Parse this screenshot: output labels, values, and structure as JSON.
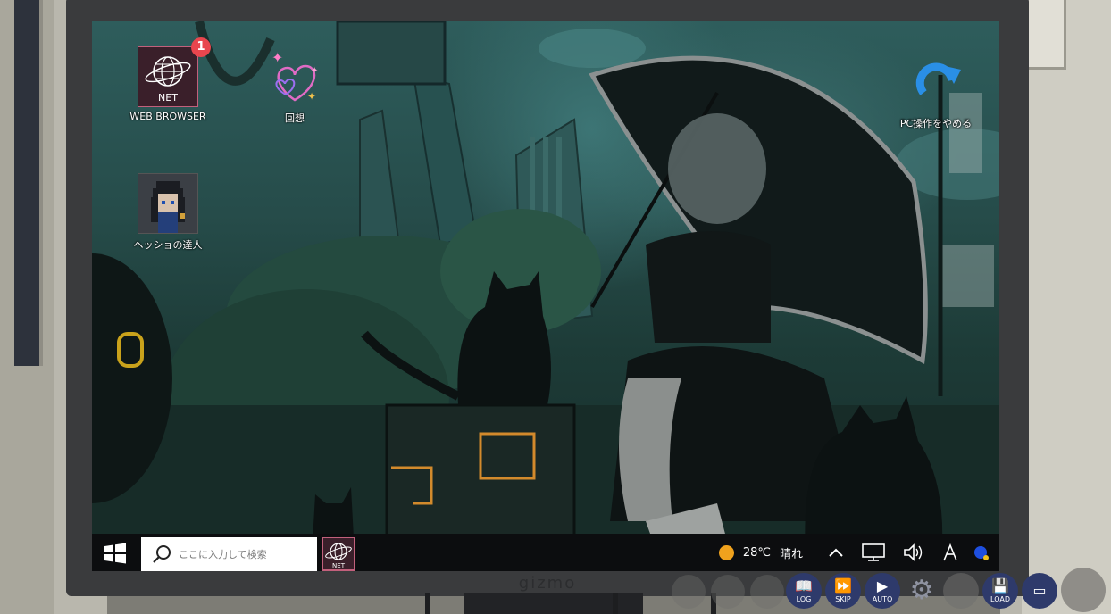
{
  "desktop": {
    "icons": {
      "browser": {
        "tile_text": "NET",
        "label": "WEB BROWSER",
        "badge": "1"
      },
      "memories": {
        "label": "回想"
      },
      "game": {
        "label": "ヘッショの達人"
      },
      "quit": {
        "label": "PC操作をやめる"
      }
    }
  },
  "taskbar": {
    "search_placeholder": "ここに入力して検索",
    "app_tile_text": "NET",
    "weather": {
      "temp": "28℃",
      "condition": "晴れ"
    }
  },
  "monitor": {
    "brand": "gizmo"
  },
  "controls": {
    "log": "LOG",
    "skip": "SKIP",
    "auto": "AUTO",
    "load": "LOAD"
  },
  "colors": {
    "accent_pink": "#c2607c",
    "badge_red": "#e8464e",
    "control_blue": "#2e3a6b",
    "sun_orange": "#f0a21d"
  }
}
